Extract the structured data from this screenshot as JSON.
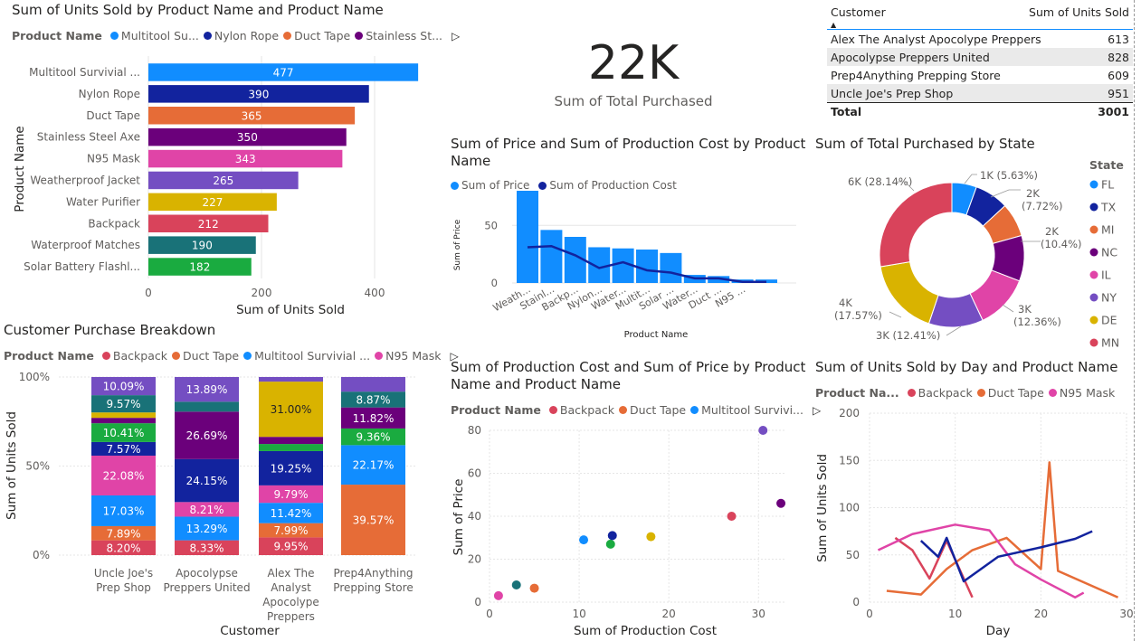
{
  "bar_visual": {
    "title": "Sum of Units Sold by Product Name and Product Name",
    "legend_title": "Product Name",
    "legend": [
      {
        "label": "Multitool Su...",
        "color": "#118DFF"
      },
      {
        "label": "Nylon Rope",
        "color": "#12239E"
      },
      {
        "label": "Duct Tape",
        "color": "#E66C37"
      },
      {
        "label": "Stainless St...",
        "color": "#6B007B"
      }
    ],
    "more_icon": "play-arrow-icon"
  },
  "kpi": {
    "value": "22K",
    "label": "Sum of Total Purchased"
  },
  "customer_table": {
    "headers": [
      "Customer",
      "Sum of Units Sold"
    ],
    "sort_icon": "sort-up-icon",
    "rows": [
      {
        "customer": "Alex The Analyst Apocolype Preppers",
        "units": "613"
      },
      {
        "customer": "Apocolypse Preppers United",
        "units": "828"
      },
      {
        "customer": "Prep4Anything Prepping Store",
        "units": "609"
      },
      {
        "customer": "Uncle Joe's Prep Shop",
        "units": "951"
      }
    ],
    "total_label": "Total",
    "total_value": "3001"
  },
  "combo_visual": {
    "title_line1": "Sum of Price and Sum of Production Cost by Product",
    "title_line2": "Name",
    "legend": [
      {
        "label": "Sum of Price",
        "color": "#118DFF"
      },
      {
        "label": "Sum of Production Cost",
        "color": "#12239E"
      }
    ]
  },
  "donut_visual": {
    "title": "Sum of Total Purchased by State",
    "legend_title": "State"
  },
  "stacked_visual": {
    "title": "Customer Purchase Breakdown",
    "legend_title": "Product Name",
    "legend": [
      {
        "label": "Backpack",
        "color": "#D9435B"
      },
      {
        "label": "Duct Tape",
        "color": "#E66C37"
      },
      {
        "label": "Multitool Survivial ...",
        "color": "#118DFF"
      },
      {
        "label": "N95 Mask",
        "color": "#E044A7"
      }
    ]
  },
  "scatter_visual": {
    "title_line1": "Sum of Production Cost and Sum of Price by Product",
    "title_line2": "Name and Product Name",
    "legend_title": "Product Name",
    "legend": [
      {
        "label": "Backpack",
        "color": "#D9435B"
      },
      {
        "label": "Duct Tape",
        "color": "#E66C37"
      },
      {
        "label": "Multitool Survivi...",
        "color": "#118DFF"
      }
    ]
  },
  "line_visual": {
    "title": "Sum of Units Sold by Day and Product Name",
    "legend_title": "Product Na...",
    "legend": [
      {
        "label": "Backpack",
        "color": "#D9435B"
      },
      {
        "label": "Duct Tape",
        "color": "#E66C37"
      },
      {
        "label": "N95 Mask",
        "color": "#E044A7"
      }
    ]
  },
  "chart_data": [
    {
      "id": "units_by_product",
      "type": "bar",
      "orientation": "horizontal",
      "title": "Sum of Units Sold by Product Name and Product Name",
      "xlabel": "Sum of Units Sold",
      "ylabel": "Product Name",
      "xlim": [
        0,
        480
      ],
      "xticks": [
        0,
        200,
        400
      ],
      "categories": [
        "Multitool Survivial ...",
        "Nylon Rope",
        "Duct Tape",
        "Stainless Steel Axe",
        "N95 Mask",
        "Weatherproof Jacket",
        "Water Purifier",
        "Backpack",
        "Waterproof Matches",
        "Solar Battery Flashl..."
      ],
      "values": [
        477,
        390,
        365,
        350,
        343,
        265,
        227,
        212,
        190,
        182
      ],
      "colors": [
        "#118DFF",
        "#12239E",
        "#E66C37",
        "#6B007B",
        "#E044A7",
        "#744EC2",
        "#D9B300",
        "#D9435B",
        "#197278",
        "#1AAB40"
      ],
      "data_labels": [
        "477",
        "390",
        "365",
        "350",
        "343",
        "265",
        "227",
        "212",
        "190",
        "182"
      ],
      "grid": true
    },
    {
      "id": "price_cost_by_product",
      "type": "bar",
      "combo_line": true,
      "title": "Sum of Price and Sum of Production Cost by Product Name",
      "xlabel": "Product Name",
      "ylabel": "Sum of Price",
      "ylim": [
        0,
        80
      ],
      "yticks": [
        0,
        50
      ],
      "categories": [
        "Weath...",
        "Stainl...",
        "Backp...",
        "Nylon...",
        "Water...",
        "Multit...",
        "Solar ...",
        "Water...",
        "Duct ...",
        "N95 ..."
      ],
      "bar_values": [
        80,
        46,
        40,
        31,
        30,
        29,
        26,
        7,
        6,
        3
      ],
      "bars_extra_unlabeled": [
        3
      ],
      "series": [
        {
          "name": "Sum of Price",
          "values": [
            80,
            46,
            40,
            31,
            30,
            29,
            26,
            7,
            6,
            3,
            3
          ],
          "color": "#118DFF"
        },
        {
          "name": "Sum of Production Cost",
          "values": [
            31,
            32,
            24,
            13,
            18,
            11,
            9,
            4,
            4,
            1,
            1
          ],
          "color": "#12239E"
        }
      ],
      "grid": true
    },
    {
      "id": "purchased_by_state",
      "type": "pie",
      "donut": true,
      "title": "Sum of Total Purchased by State",
      "legend_title": "State",
      "slices": [
        {
          "label": "FL",
          "value": 5.63,
          "text": "1K (5.63%)",
          "color": "#118DFF"
        },
        {
          "label": "TX",
          "value": 7.72,
          "text": "2K (7.72%)",
          "color": "#12239E"
        },
        {
          "label": "MI",
          "value": 7.72,
          "text": "",
          "color": "#E66C37"
        },
        {
          "label": "NC",
          "value": 10.4,
          "text": "2K (10.4%)",
          "color": "#6B007B"
        },
        {
          "label": "IL",
          "value": 12.36,
          "text": "3K (12.36%)",
          "color": "#E044A7"
        },
        {
          "label": "NY",
          "value": 12.41,
          "text": "3K (12.41%)",
          "color": "#744EC2"
        },
        {
          "label": "DE",
          "value": 17.57,
          "text": "4K (17.57%)",
          "color": "#D9B300"
        },
        {
          "label": "MN",
          "value": 28.14,
          "text": "6K (28.14%)",
          "color": "#D9435B"
        }
      ],
      "legend_placement": "right"
    },
    {
      "id": "customer_breakdown",
      "type": "bar",
      "stacked": "100%",
      "title": "Customer Purchase Breakdown",
      "xlabel": "Customer",
      "ylabel": "Sum of Units Sold",
      "yticks": [
        "0%",
        "50%",
        "100%"
      ],
      "categories": [
        "Uncle Joe's Prep Shop",
        "Apocolypse Preppers United",
        "Alex The Analyst Apocolype Preppers",
        "Prep4Anything Prepping Store"
      ],
      "category_lines": [
        [
          "Uncle Joe's",
          "Prep Shop"
        ],
        [
          "Apocolypse",
          "Preppers United"
        ],
        [
          "Alex The",
          "Analyst",
          "Apocolype",
          "Preppers"
        ],
        [
          "Prep4Anything",
          "Prepping Store"
        ]
      ],
      "series": [
        {
          "name": "Backpack",
          "color": "#D9435B",
          "values": [
            8.2,
            8.33,
            9.95,
            0
          ]
        },
        {
          "name": "Duct Tape",
          "color": "#E66C37",
          "values": [
            7.89,
            0,
            7.99,
            39.57
          ]
        },
        {
          "name": "Multitool Survivial Kit",
          "color": "#118DFF",
          "values": [
            17.03,
            13.29,
            11.42,
            22.17
          ]
        },
        {
          "name": "N95 Mask",
          "color": "#E044A7",
          "values": [
            22.08,
            8.21,
            9.79,
            0
          ]
        },
        {
          "name": "Nylon Rope",
          "color": "#12239E",
          "values": [
            7.57,
            24.15,
            19.25,
            0
          ]
        },
        {
          "name": "Solar Battery Flashlight",
          "color": "#1AAB40",
          "values": [
            10.41,
            0,
            4.0,
            9.36
          ]
        },
        {
          "name": "Stainless Steel Axe",
          "color": "#6B007B",
          "values": [
            3.0,
            26.69,
            4.0,
            11.82
          ]
        },
        {
          "name": "Water Purifier",
          "color": "#D9B300",
          "values": [
            3.0,
            0,
            31.0,
            0
          ]
        },
        {
          "name": "Waterproof Matches",
          "color": "#197278",
          "values": [
            9.57,
            5.59,
            0,
            8.87
          ]
        },
        {
          "name": "Weatherproof Jacket",
          "color": "#744EC2",
          "values": [
            10.09,
            13.89,
            2.6,
            8.21
          ]
        }
      ],
      "labels": [
        [
          "8.20%",
          "7.89%",
          "17.03%",
          "22.08%",
          "7.57%",
          "10.41%",
          "",
          "",
          "9.57%",
          "10.09%"
        ],
        [
          "8.33%",
          "",
          "13.29%",
          "8.21%",
          "24.15%",
          "",
          "26.69%",
          "",
          "",
          "13.89%"
        ],
        [
          "9.95%",
          "7.99%",
          "11.42%",
          "9.79%",
          "19.25%",
          "",
          "",
          "31.00%",
          "",
          ""
        ],
        [
          "",
          "39.57%",
          "22.17%",
          "",
          "",
          "9.36%",
          "11.82%",
          "",
          "8.87%",
          ""
        ]
      ]
    },
    {
      "id": "cost_vs_price",
      "type": "scatter",
      "title": "Sum of Production Cost and Sum of Price by Product Name and Product Name",
      "xlabel": "Sum of Production Cost",
      "ylabel": "Sum of Price",
      "xlim": [
        0,
        33
      ],
      "ylim": [
        0,
        80
      ],
      "xticks": [
        0,
        10,
        20,
        30
      ],
      "yticks": [
        0,
        20,
        40,
        60,
        80
      ],
      "points": [
        {
          "x": 1,
          "y": 3,
          "color": "#E044A7"
        },
        {
          "x": 3,
          "y": 8,
          "color": "#197278"
        },
        {
          "x": 5,
          "y": 6.5,
          "color": "#E66C37"
        },
        {
          "x": 10.5,
          "y": 29,
          "color": "#118DFF"
        },
        {
          "x": 13.5,
          "y": 27,
          "color": "#1AAB40"
        },
        {
          "x": 13.7,
          "y": 31,
          "color": "#12239E"
        },
        {
          "x": 18,
          "y": 30.5,
          "color": "#D9B300"
        },
        {
          "x": 27,
          "y": 40,
          "color": "#D9435B"
        },
        {
          "x": 30.5,
          "y": 80,
          "color": "#744EC2"
        },
        {
          "x": 32.5,
          "y": 46,
          "color": "#6B007B"
        }
      ],
      "grid": true
    },
    {
      "id": "units_by_day",
      "type": "line",
      "title": "Sum of Units Sold by Day and Product Name",
      "xlabel": "Day",
      "ylabel": "Sum of Units Sold",
      "xlim": [
        0,
        30
      ],
      "ylim": [
        0,
        200
      ],
      "xticks": [
        0,
        10,
        20,
        30
      ],
      "yticks": [
        0,
        50,
        100,
        150,
        200
      ],
      "series": [
        {
          "name": "Backpack",
          "color": "#D9435B",
          "x": [
            3,
            5,
            7,
            9,
            12
          ],
          "y": [
            68,
            55,
            25,
            65,
            5
          ]
        },
        {
          "name": "Duct Tape",
          "color": "#E66C37",
          "x": [
            2,
            6,
            9,
            12,
            16,
            20,
            21,
            22,
            29
          ],
          "y": [
            12,
            8,
            35,
            55,
            68,
            35,
            148,
            33,
            5
          ]
        },
        {
          "name": "N95 Mask",
          "color": "#E044A7",
          "x": [
            1,
            5,
            10,
            14,
            17,
            20,
            24,
            25
          ],
          "y": [
            55,
            72,
            82,
            76,
            40,
            24,
            5,
            10
          ]
        },
        {
          "name": "Nylon Rope",
          "color": "#12239E",
          "x": [
            6,
            8,
            9,
            11,
            15,
            20,
            24,
            26
          ],
          "y": [
            65,
            48,
            68,
            22,
            48,
            58,
            67,
            75
          ]
        }
      ],
      "grid": true
    }
  ]
}
